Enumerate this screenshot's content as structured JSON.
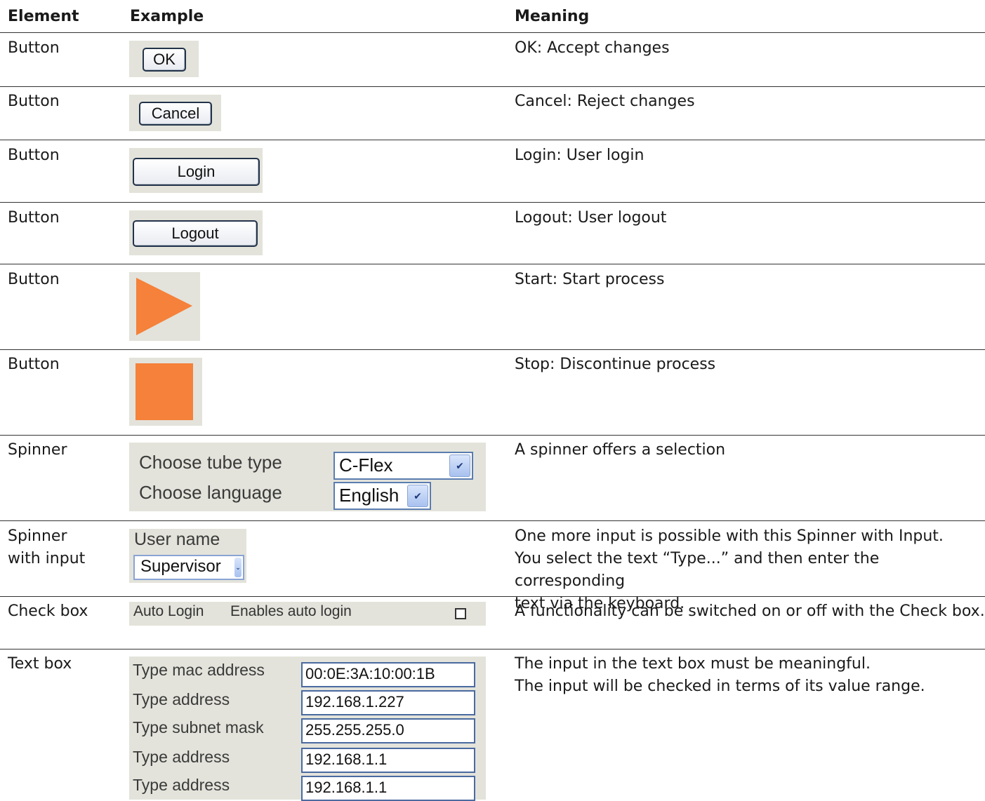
{
  "headers": {
    "element": "Element",
    "example": "Example",
    "meaning": "Meaning"
  },
  "rows": {
    "ok": {
      "element": "Button",
      "ui": {
        "label": "OK"
      },
      "meaning": "OK: Accept changes"
    },
    "cancel": {
      "element": "Button",
      "ui": {
        "label": "Cancel"
      },
      "meaning": "Cancel: Reject changes"
    },
    "login": {
      "element": "Button",
      "ui": {
        "label": "Login"
      },
      "meaning": "Login: User login"
    },
    "logout": {
      "element": "Button",
      "ui": {
        "label": "Logout"
      },
      "meaning": "Logout: User logout"
    },
    "start": {
      "element": "Button",
      "ui": {
        "icon": "play-icon",
        "color": "#f5813a"
      },
      "meaning": "Start: Start process"
    },
    "stop": {
      "element": "Button",
      "ui": {
        "icon": "stop-icon",
        "color": "#f5813a"
      },
      "meaning": "Stop: Discontinue process"
    },
    "spinner": {
      "element": "Spinner",
      "ui": {
        "tube_label": "Choose tube type",
        "tube_value": "C-Flex",
        "language_label": "Choose language",
        "language_value": "English"
      },
      "meaning": "A spinner offers a selection"
    },
    "spinner_input": {
      "element_line1": "Spinner",
      "element_line2": "with input",
      "ui": {
        "label": "User name",
        "value": "Supervisor"
      },
      "meaning_lines": [
        "One more input is possible with this Spinner with Input.",
        "You select the text “Type...” and then enter the corresponding",
        "text via the keyboard."
      ]
    },
    "checkbox": {
      "element": "Check box",
      "ui": {
        "name": "Auto Login",
        "description": "Enables auto login",
        "checked": false
      },
      "meaning": "A functionality can be switched on or off with the Check box."
    },
    "textbox": {
      "element": "Text box",
      "ui": {
        "fields": [
          {
            "label": "Type mac address",
            "value": "00:0E:3A:10:00:1B"
          },
          {
            "label": "Type address",
            "value": "192.168.1.227"
          },
          {
            "label": "Type subnet mask",
            "value": "255.255.255.0"
          },
          {
            "label": "Type address",
            "value": "192.168.1.1"
          },
          {
            "label": "Type address",
            "value": "192.168.1.1"
          }
        ]
      },
      "meaning_lines": [
        "The input in the text box must be meaningful.",
        "The input will be checked in terms of its value range."
      ]
    }
  },
  "colors": {
    "accent_orange": "#f5813a",
    "panel_gray": "#e3e3db",
    "rule": "#333333"
  }
}
